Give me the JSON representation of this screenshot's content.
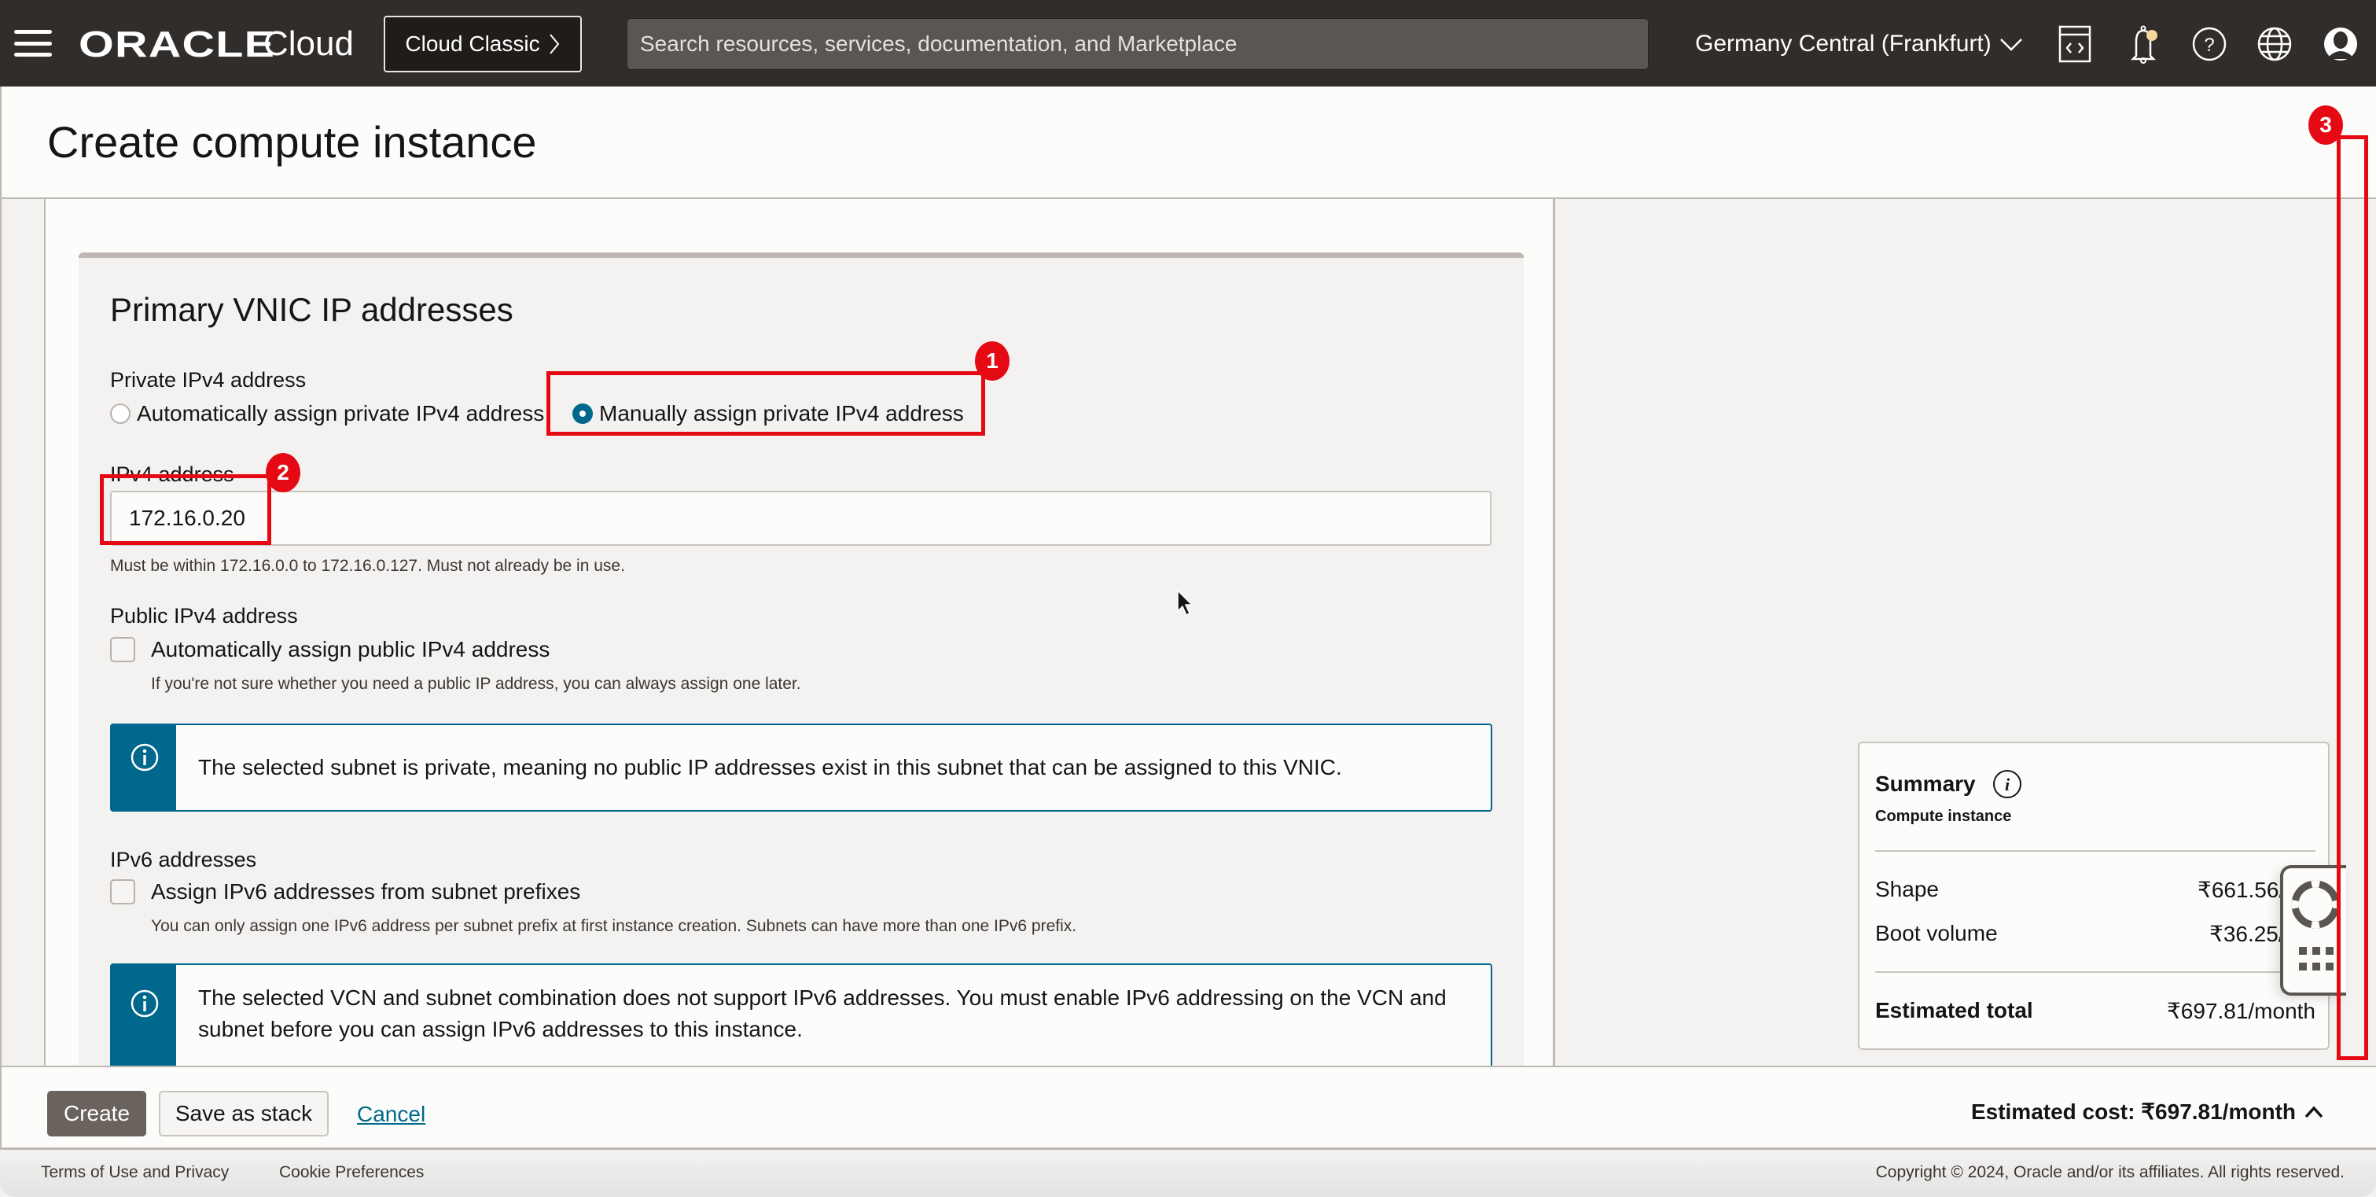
{
  "header": {
    "brand": "ORACLE",
    "product": "Cloud",
    "classic_button": "Cloud Classic",
    "search_placeholder": "Search resources, services, documentation, and Marketplace",
    "region": "Germany Central (Frankfurt)",
    "icons": [
      "hamburger-menu-icon",
      "code-editor-icon",
      "notification-bell-icon",
      "help-icon",
      "language-globe-icon",
      "user-profile-icon"
    ]
  },
  "page": {
    "title": "Create compute instance"
  },
  "form": {
    "section_title": "Primary VNIC IP addresses",
    "private_ipv4": {
      "label": "Private IPv4 address",
      "options": [
        {
          "label": "Automatically assign private IPv4 address",
          "checked": false
        },
        {
          "label": "Manually assign private IPv4 address",
          "checked": true
        }
      ]
    },
    "ipv4_address": {
      "label": "IPv4 address",
      "value": "172.16.0.20",
      "help": "Must be within 172.16.0.0 to 172.16.0.127. Must not already be in use."
    },
    "public_ipv4": {
      "label": "Public IPv4 address",
      "checkbox_label": "Automatically assign public IPv4 address",
      "checked": false,
      "help": "If you're not sure whether you need a public IP address, you can always assign one later."
    },
    "info_private_subnet": "The selected subnet is private, meaning no public IP addresses exist in this subnet that can be assigned to this VNIC.",
    "ipv6": {
      "label": "IPv6 addresses",
      "checkbox_label": "Assign IPv6 addresses from subnet prefixes",
      "checked": false,
      "help": "You can only assign one IPv6 address per subnet prefix at first instance creation. Subnets can have more than one IPv6 prefix."
    },
    "info_ipv6": "The selected VCN and subnet combination does not support IPv6 addresses. You must enable IPv6 addressing on the VCN and subnet before you can assign IPv6 addresses to this instance."
  },
  "summary": {
    "title": "Summary",
    "subtitle": "Compute instance",
    "rows": [
      {
        "label": "Shape",
        "value": "₹661.56/month"
      },
      {
        "label": "Boot volume",
        "value": "₹36.25/month"
      }
    ],
    "total_label": "Estimated total",
    "total_value": "₹697.81/month"
  },
  "actions": {
    "create": "Create",
    "save_stack": "Save as stack",
    "cancel": "Cancel",
    "estimated_cost": "Estimated cost: ₹697.81/month"
  },
  "footer": {
    "terms": "Terms of Use and Privacy",
    "cookies": "Cookie Preferences",
    "copyright": "Copyright © 2024, Oracle and/or its affiliates. All rights reserved."
  },
  "annotations": [
    {
      "number": "1",
      "target": "Manually assign private IPv4 address"
    },
    {
      "number": "2",
      "target": "IPv4 address input"
    },
    {
      "number": "3",
      "target": "page scrollbar"
    }
  ],
  "colors": {
    "header_bg": "#312d2a",
    "accent": "#00688c",
    "primary_button": "#6a625d",
    "annotation_red": "#e50914"
  }
}
